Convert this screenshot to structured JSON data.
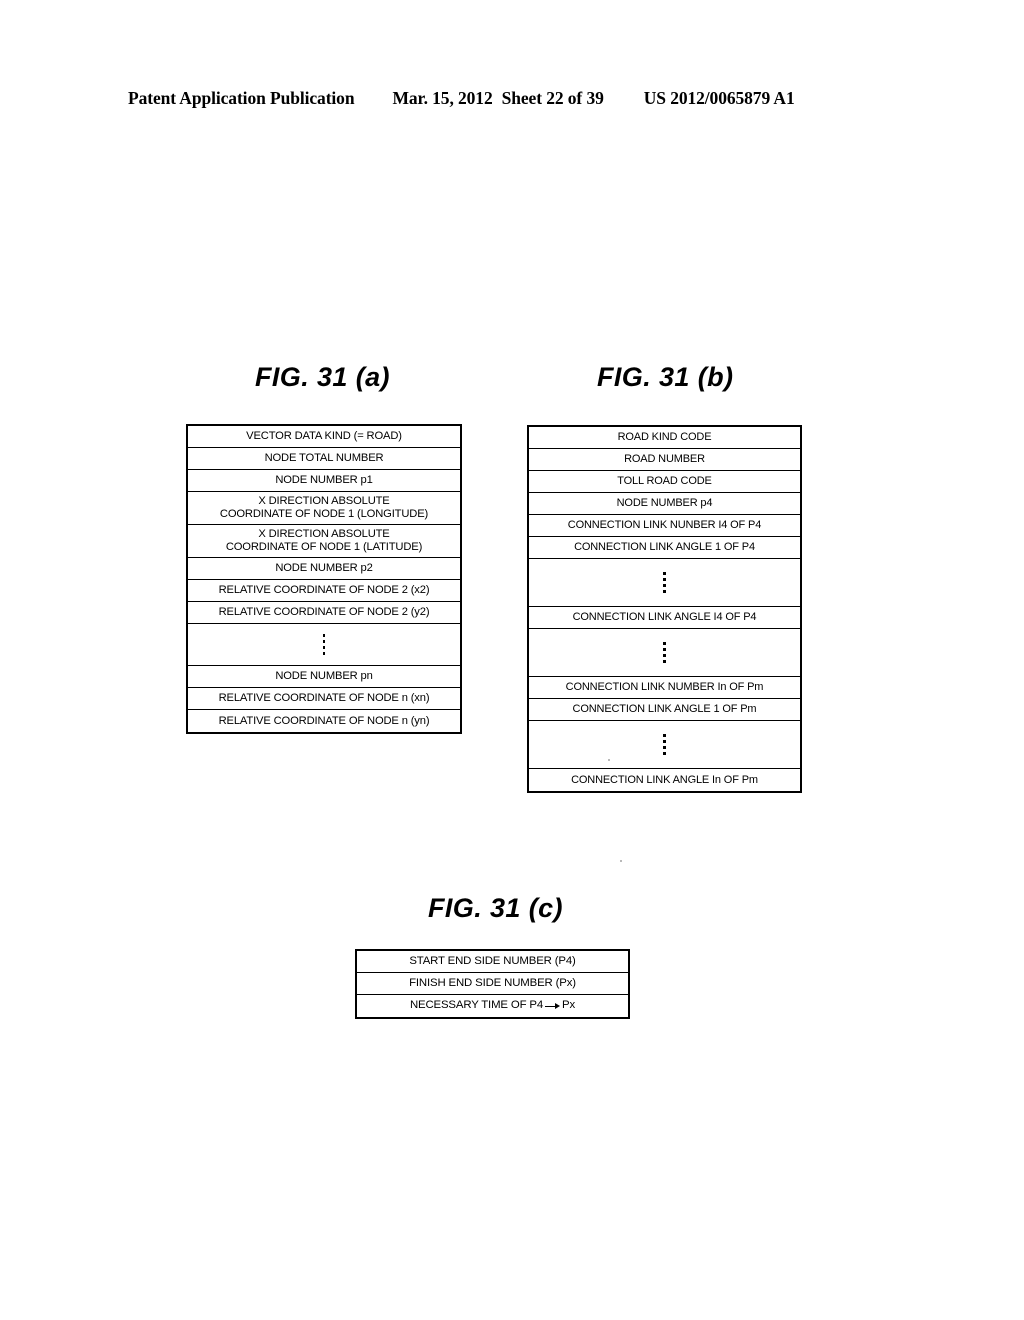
{
  "header": {
    "publication": "Patent Application Publication",
    "date": "Mar. 15, 2012",
    "sheet": "Sheet 22 of 39",
    "patent_number": "US 2012/0065879 A1"
  },
  "figures": {
    "a": {
      "title": "FIG. 31 (a)",
      "rows": [
        {
          "type": "text",
          "label": "VECTOR DATA KIND (= ROAD)"
        },
        {
          "type": "text",
          "label": "NODE TOTAL NUMBER"
        },
        {
          "type": "text",
          "label": "NODE NUMBER p1"
        },
        {
          "type": "text2",
          "line1": "X DIRECTION ABSOLUTE",
          "line2": "COORDINATE OF NODE 1 (LONGITUDE)"
        },
        {
          "type": "text2",
          "line1": "X DIRECTION ABSOLUTE",
          "line2": "COORDINATE OF NODE 1 (LATITUDE)"
        },
        {
          "type": "text",
          "label": "NODE NUMBER p2"
        },
        {
          "type": "text",
          "label": "RELATIVE COORDINATE OF NODE 2 (x2)"
        },
        {
          "type": "text",
          "label": "RELATIVE COORDINATE OF NODE 2 (y2)"
        },
        {
          "type": "ellipsis",
          "label": ""
        },
        {
          "type": "text",
          "label": "NODE NUMBER pn"
        },
        {
          "type": "text",
          "label": "RELATIVE COORDINATE OF NODE n (xn)"
        },
        {
          "type": "text",
          "label": "RELATIVE COORDINATE OF NODE n (yn)"
        }
      ]
    },
    "b": {
      "title": "FIG. 31 (b)",
      "rows": [
        {
          "type": "text",
          "label": "ROAD KIND CODE"
        },
        {
          "type": "text",
          "label": "ROAD NUMBER"
        },
        {
          "type": "text",
          "label": "TOLL ROAD CODE"
        },
        {
          "type": "text",
          "label": "NODE NUMBER p4"
        },
        {
          "type": "text",
          "label": "CONNECTION LINK NUNBER I4 OF P4"
        },
        {
          "type": "text",
          "label": "CONNECTION LINK ANGLE 1 OF P4"
        },
        {
          "type": "ellipsis",
          "label": ""
        },
        {
          "type": "text",
          "label": "CONNECTION LINK ANGLE I4 OF P4"
        },
        {
          "type": "ellipsis",
          "label": ""
        },
        {
          "type": "text",
          "label": "CONNECTION LINK NUMBER In OF Pm"
        },
        {
          "type": "text",
          "label": "CONNECTION LINK ANGLE 1 OF Pm"
        },
        {
          "type": "ellipsis",
          "label": ""
        },
        {
          "type": "text",
          "label": "CONNECTION LINK ANGLE In OF Pm"
        }
      ]
    },
    "c": {
      "title": "FIG. 31 (c)",
      "rows": [
        {
          "type": "text",
          "label": "START END SIDE NUMBER (P4)"
        },
        {
          "type": "text",
          "label": "FINISH END SIDE NUMBER (Px)"
        },
        {
          "type": "arrow",
          "prefix": "NECESSARY TIME OF P4",
          "suffix": "Px"
        }
      ]
    }
  }
}
